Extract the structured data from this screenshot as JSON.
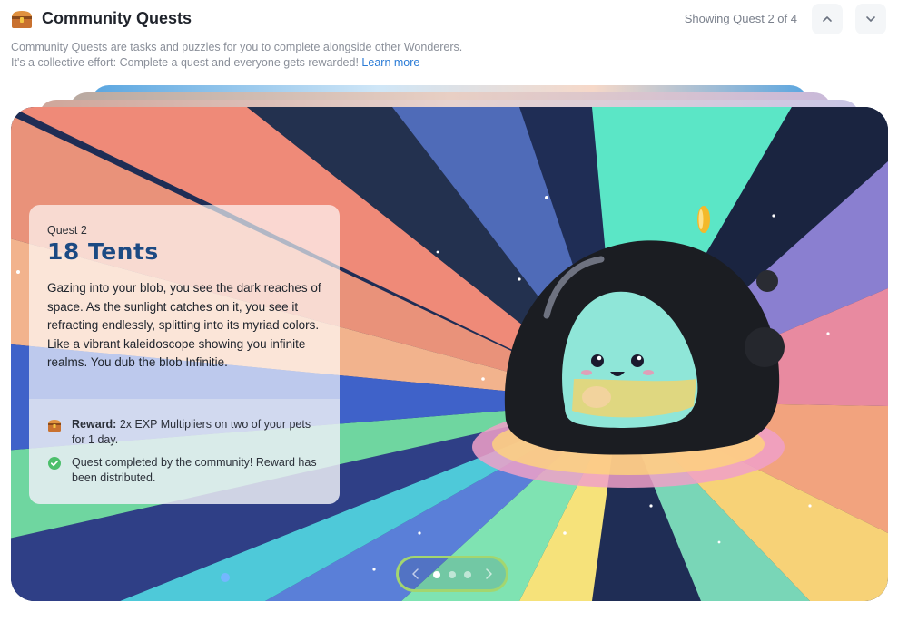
{
  "header": {
    "title": "Community Quests",
    "showing": "Showing Quest 2 of 4",
    "icons": {
      "title": "treasure-chest-icon",
      "up": "chevron-up-icon",
      "down": "chevron-down-icon"
    }
  },
  "description": {
    "line1": "Community Quests are tasks and puzzles for you to complete alongside other Wonderers.",
    "line2": "It's a collective effort: Complete a quest and everyone gets rewarded!",
    "learn_more": "Learn more"
  },
  "quest": {
    "number_label": "Quest 2",
    "name": "18 Tents",
    "story": "Gazing into your blob, you see the dark reaches of space. As the sunlight catches on it, you see it refracting endlessly, splitting into its myriad colors. Like a vibrant kaleidoscope showing you infinite realms. You dub the blob Infinitie.",
    "reward_label": "Reward:",
    "reward_text": "2x EXP Multipliers on two of your pets for 1 day.",
    "status_text": "Quest completed by the community! Reward has been distributed.",
    "icons": {
      "reward": "treasure-chest-icon",
      "status": "check-circle-icon"
    }
  },
  "pager": {
    "current_index": 1,
    "page_count": 3,
    "icons": {
      "prev": "chevron-left-icon",
      "next": "chevron-right-icon"
    }
  },
  "colors": {
    "accent": "#2a7bd6",
    "title_blue": "#1c4a83",
    "pager_border": "#a3d66f",
    "success": "#4cbf6b"
  }
}
